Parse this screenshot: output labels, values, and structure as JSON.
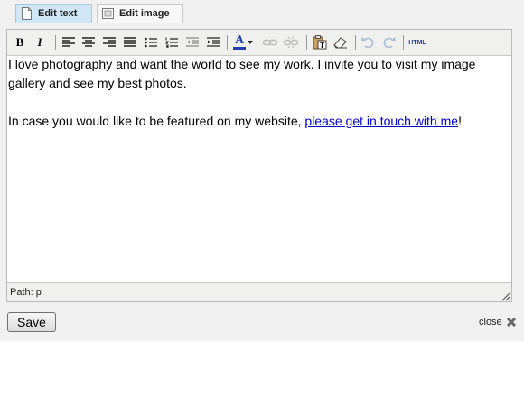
{
  "tabs": [
    {
      "label": "Edit text",
      "icon": "page-icon",
      "active": true
    },
    {
      "label": "Edit image",
      "icon": "image-icon",
      "active": false
    }
  ],
  "toolbar": {
    "buttons": [
      {
        "name": "bold-button",
        "glyph": "B"
      },
      {
        "name": "italic-button",
        "glyph": "I"
      },
      {
        "name": "align-left-button",
        "glyph": ""
      },
      {
        "name": "align-center-button",
        "glyph": ""
      },
      {
        "name": "align-right-button",
        "glyph": ""
      },
      {
        "name": "align-justify-button",
        "glyph": ""
      },
      {
        "name": "bullet-list-button",
        "glyph": ""
      },
      {
        "name": "numbered-list-button",
        "glyph": ""
      },
      {
        "name": "outdent-button",
        "glyph": ""
      },
      {
        "name": "indent-button",
        "glyph": ""
      },
      {
        "name": "text-color-button",
        "glyph": "A"
      },
      {
        "name": "link-button",
        "glyph": ""
      },
      {
        "name": "unlink-button",
        "glyph": ""
      },
      {
        "name": "paste-text-button",
        "glyph": ""
      },
      {
        "name": "remove-format-button",
        "glyph": ""
      },
      {
        "name": "undo-button",
        "glyph": ""
      },
      {
        "name": "redo-button",
        "glyph": ""
      },
      {
        "name": "html-button",
        "glyph": "HTML"
      }
    ],
    "text_color": "#1f3fb0"
  },
  "content": {
    "paragraph1": "I love photography and want the world to see my work. I invite you to visit my image gallery and see my best photos.",
    "paragraph2_text": "In case you would like to be featured on my website, ",
    "paragraph2_link": "please get in touch with me",
    "paragraph2_end": "!"
  },
  "statusbar": {
    "path": "Path: p"
  },
  "save_label": "Save",
  "close_label": "close",
  "colors": {
    "active_tab": "#cfe7f7",
    "link": "#0000cc",
    "toolbar_bg": "#f0f0ee"
  }
}
